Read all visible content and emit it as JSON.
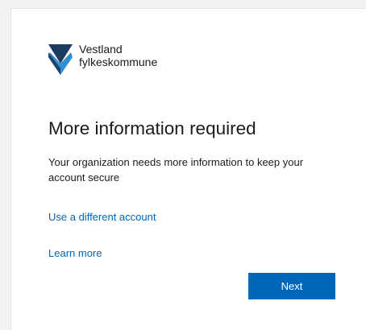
{
  "brand": {
    "line1": "Vestland",
    "line2": "fylkeskommune",
    "colors": {
      "dark": "#1d3a5f",
      "light": "#2f8fd1"
    }
  },
  "page": {
    "title": "More information required",
    "description": "Your organization needs more information to keep your account secure"
  },
  "links": {
    "different_account": "Use a different account",
    "learn_more": "Learn more"
  },
  "actions": {
    "next_label": "Next"
  },
  "colors": {
    "accent": "#0067b8",
    "text": "#1b1b1b",
    "background": "#ffffff"
  }
}
